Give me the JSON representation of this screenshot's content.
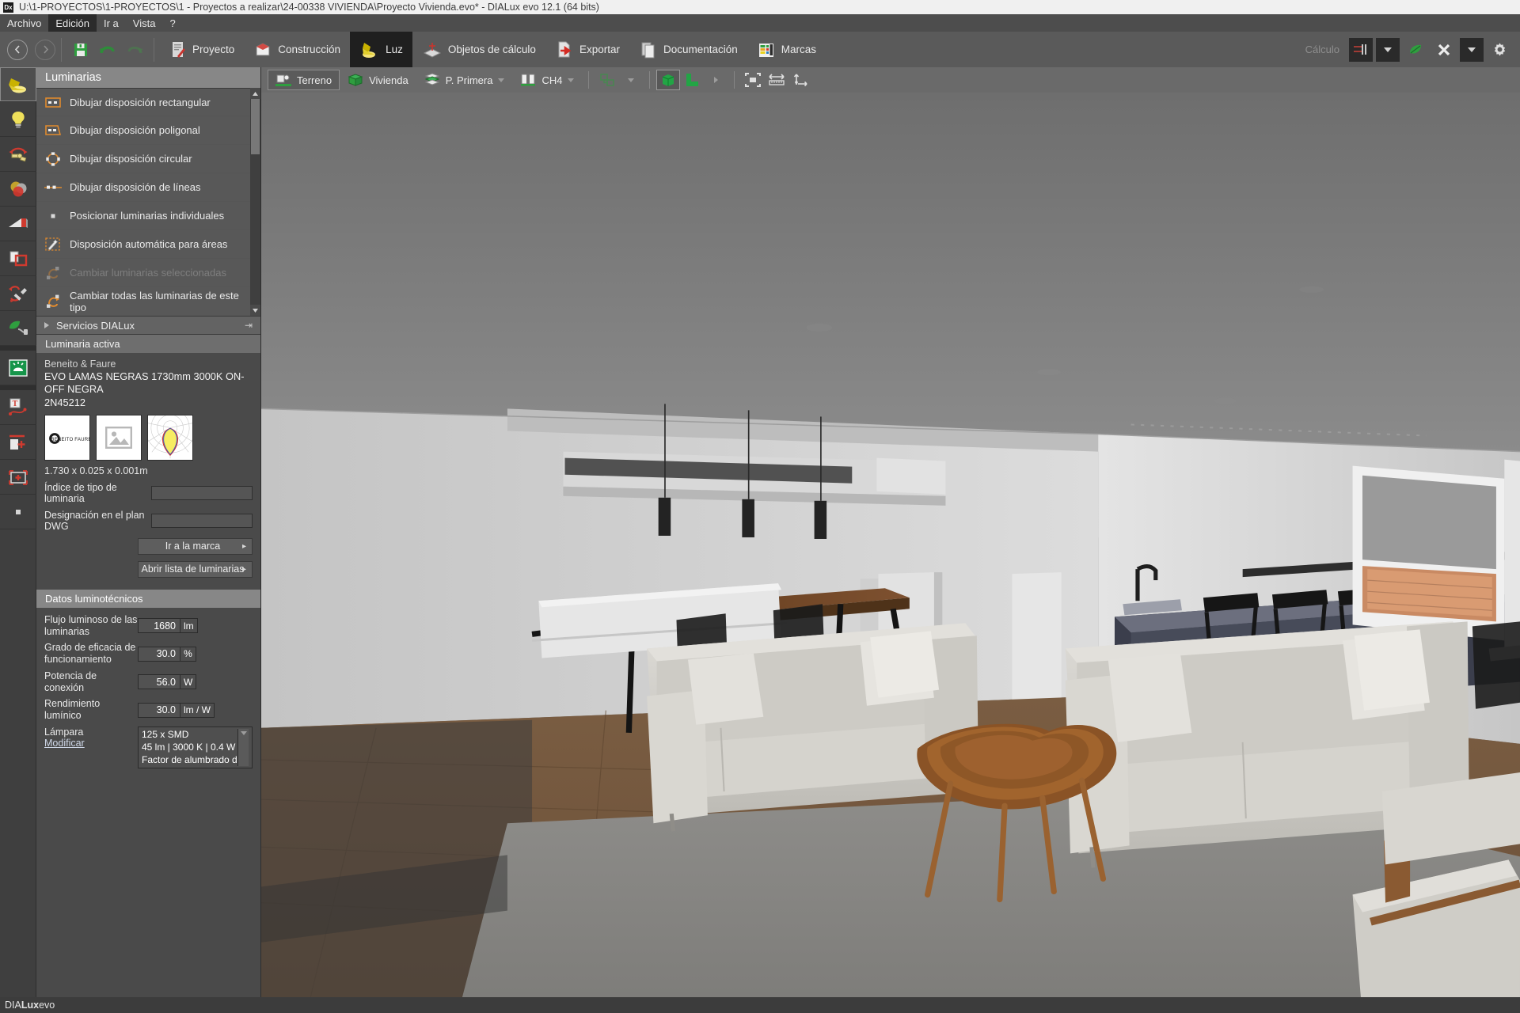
{
  "window": {
    "title": "U:\\1-PROYECTOS\\1-PROYECTOS\\1 - Proyectos a realizar\\24-00338 VIVIENDA\\Proyecto Vivienda.evo* - DIALux evo 12.1  (64 bits)",
    "logo": "Dx"
  },
  "menu": {
    "items": [
      {
        "label": "Archivo",
        "active": false
      },
      {
        "label": "Edición",
        "active": true
      },
      {
        "label": "Ir a",
        "active": false
      },
      {
        "label": "Vista",
        "active": false
      },
      {
        "label": "?",
        "active": false
      }
    ]
  },
  "toolbar": {
    "back_icon": "arrow-left-icon",
    "forward_icon": "arrow-right-icon",
    "save_icon": "save-icon",
    "undo_icon": "undo-icon",
    "redo_icon": "redo-icon",
    "tabs": [
      {
        "label": "Proyecto",
        "icon": "project-icon",
        "active": false
      },
      {
        "label": "Construcción",
        "icon": "construction-icon",
        "active": false
      },
      {
        "label": "Luz",
        "icon": "light-icon",
        "active": true
      },
      {
        "label": "Objetos de cálculo",
        "icon": "calculation-objects-icon",
        "active": false
      },
      {
        "label": "Exportar",
        "icon": "export-icon",
        "active": false
      },
      {
        "label": "Documentación",
        "icon": "documentation-icon",
        "active": false
      },
      {
        "label": "Marcas",
        "icon": "brands-icon",
        "active": false
      }
    ],
    "calculation_label": "Cálculo",
    "calc_start_icon": "start-calculation-icon",
    "calc_dropdown_icon": "chevron-down-icon",
    "leaf_icon": "leaf-icon",
    "stop_icon": "close-x-icon",
    "stop_dropdown_icon": "chevron-down-icon",
    "settings_icon": "gear-icon"
  },
  "rail": {
    "items": [
      {
        "name": "spotlight-tool",
        "icon": "spotlight-icon",
        "selected": true
      },
      {
        "name": "lamp-tool",
        "icon": "bulb-icon",
        "selected": false
      },
      {
        "name": "rotate-luminaire-tool",
        "icon": "rotate-luminaire-icon",
        "selected": false
      },
      {
        "name": "light-color-tool",
        "icon": "color-circles-icon",
        "selected": false
      },
      {
        "name": "light-scene-tool",
        "icon": "wedge-icon",
        "selected": false
      },
      {
        "name": "light-zone-tool",
        "icon": "zone-icon",
        "selected": false
      },
      {
        "name": "maintenance-tool",
        "icon": "wrench-icon",
        "selected": false
      },
      {
        "name": "energy-tool",
        "icon": "leaf-plug-icon",
        "selected": false
      },
      {
        "name": "emergency-light-tool",
        "icon": "emergency-sign-icon",
        "selected": false
      },
      {
        "name": "text-path-tool",
        "icon": "text-path-icon",
        "selected": false
      },
      {
        "name": "add-surface-tool",
        "icon": "add-surface-icon",
        "selected": false
      },
      {
        "name": "add-area-tool",
        "icon": "add-area-icon",
        "selected": false
      },
      {
        "name": "point-tool",
        "icon": "point-icon",
        "selected": false
      }
    ]
  },
  "panel": {
    "header": "Luminarias",
    "commands": [
      {
        "label": "Dibujar disposición rectangular",
        "icon": "rect-layout-icon",
        "disabled": false
      },
      {
        "label": "Dibujar disposición poligonal",
        "icon": "polygon-layout-icon",
        "disabled": false
      },
      {
        "label": "Dibujar disposición circular",
        "icon": "circular-layout-icon",
        "disabled": false
      },
      {
        "label": "Dibujar disposición de líneas",
        "icon": "line-layout-icon",
        "disabled": false
      },
      {
        "label": "Posicionar luminarias individuales",
        "icon": "single-luminaire-icon",
        "disabled": false
      },
      {
        "label": "Disposición automática para áreas",
        "icon": "auto-layout-icon",
        "disabled": false
      },
      {
        "label": "Cambiar luminarias seleccionadas",
        "icon": "swap-selected-icon",
        "disabled": true
      },
      {
        "label": "Cambiar todas las luminarias de este tipo",
        "icon": "swap-all-icon",
        "disabled": false
      }
    ],
    "services_row": {
      "label": "Servicios DIALux",
      "expand_icon": "triangle-right-icon",
      "pin_icon": "pin-icon"
    },
    "active_luminaire": {
      "section_title": "Luminaria activa",
      "manufacturer": "Beneito & Faure",
      "model": "EVO LAMAS NEGRAS 1730mm 3000K ON-OFF NEGRA",
      "code": "2N45212",
      "thumb_logo_text": "BENEITO FAURE",
      "thumb_photo_icon": "image-placeholder-icon",
      "thumb_ldc_icon": "light-distribution-curve-icon",
      "dimensions": "1.730 x 0.025 x 0.001m",
      "fields": [
        {
          "label": "Índice de tipo de luminaria",
          "value": ""
        },
        {
          "label": "Designación en el plan DWG",
          "value": ""
        }
      ],
      "buttons": [
        {
          "label": "Ir a la marca",
          "arrow": "▸"
        },
        {
          "label": "Abrir lista de luminarias",
          "arrow": "▸"
        }
      ]
    },
    "photometric": {
      "section_title": "Datos luminotécnicos",
      "rows": [
        {
          "label": "Flujo luminoso de las luminarias",
          "value": "1680",
          "unit": "lm"
        },
        {
          "label": "Grado de eficacia de funcionamiento",
          "value": "30.0",
          "unit": "%"
        },
        {
          "label": "Potencia de conexión",
          "value": "56.0",
          "unit": "W"
        },
        {
          "label": "Rendimiento lumínico",
          "value": "30.0",
          "unit": "lm / W"
        }
      ],
      "lamp": {
        "label": "Lámpara",
        "modify_link": "Modificar",
        "line1": "125 x SMD",
        "line2": "45 lm  |  3000 K  |  0.4 W",
        "line3": "Factor de alumbrado de emergenc",
        "dropdown_icon": "chevron-down-icon"
      }
    }
  },
  "viewport": {
    "tabs": [
      {
        "label": "Terreno",
        "icon": "terrain-icon",
        "selected": true,
        "dropdown": false
      },
      {
        "label": "Vivienda",
        "icon": "building-icon",
        "selected": false,
        "dropdown": false
      },
      {
        "label": "P. Primera",
        "icon": "floor-icon",
        "selected": false,
        "dropdown": true
      },
      {
        "label": "CH4",
        "icon": "room-icon",
        "selected": false,
        "dropdown": true
      }
    ],
    "tools": [
      {
        "name": "furniture-toggle",
        "icon": "furniture-icon",
        "selected": false,
        "dropdown": true
      },
      {
        "name": "solid-view-button",
        "icon": "solid-cube-icon",
        "selected": true,
        "dropdown": false
      },
      {
        "name": "corner-view-button",
        "icon": "corner-shape-icon",
        "selected": false,
        "dropdown": true
      },
      {
        "name": "fit-view-button",
        "icon": "fit-to-screen-icon",
        "selected": false,
        "dropdown": false
      },
      {
        "name": "measure-horizontal-button",
        "icon": "measure-horizontal-icon",
        "selected": false,
        "dropdown": false
      },
      {
        "name": "measure-vertical-button",
        "icon": "measure-vertical-icon",
        "selected": false,
        "dropdown": false
      }
    ]
  },
  "status": {
    "brand_pre": "DIA",
    "brand_bold": "Lux",
    "brand_post": "evo"
  }
}
